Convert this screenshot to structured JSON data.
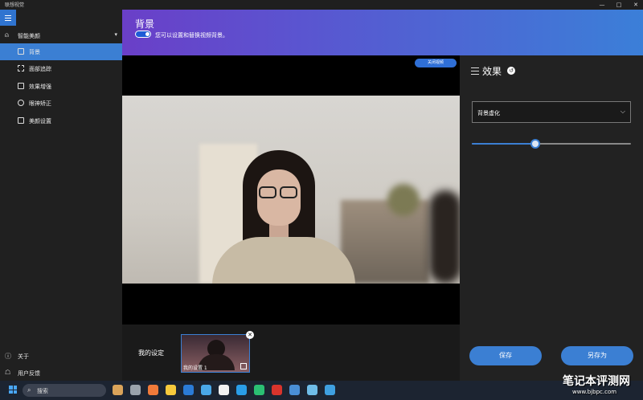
{
  "window": {
    "title": "联想视觉",
    "controls": [
      "—",
      "□",
      "✕"
    ]
  },
  "sidebar": {
    "group_label": "智能美颜",
    "items": [
      {
        "label": "背景",
        "active": true
      },
      {
        "label": "面部追踪",
        "active": false
      },
      {
        "label": "效果增强",
        "active": false
      },
      {
        "label": "眼神矫正",
        "active": false
      },
      {
        "label": "美颜设置",
        "active": false
      }
    ],
    "bottom": [
      {
        "label": "关于",
        "icon": "info-icon"
      },
      {
        "label": "用户反馈",
        "icon": "feedback-icon"
      }
    ]
  },
  "header": {
    "title": "背景",
    "toggle_on": true,
    "description": "您可以设置和替换视频背景。"
  },
  "video": {
    "close_label": "关闭视频"
  },
  "my_settings": {
    "label": "我的设定",
    "preset_name": "我的设置 1"
  },
  "panel": {
    "title": "效果",
    "select_value": "背景虚化",
    "slider_level": 0.4
  },
  "buttons": {
    "save": "保存",
    "save_as": "另存为"
  },
  "taskbar": {
    "search_text": "搜索",
    "icon_colors": [
      "#d9a35a",
      "#9aa3ad",
      "#f07a3a",
      "#f6c93c",
      "#2b7bd6",
      "#4aa8e8",
      "#f2f2f2",
      "#2a9ee8",
      "#2bbf73",
      "#d8342c",
      "#4a8fd6",
      "#6fbde8",
      "#3fa0e0"
    ]
  },
  "watermark": {
    "main": "笔记本评测网",
    "sub": "www.bjbpc.com"
  },
  "colors": {
    "accent": "#3b7fd3",
    "banner_start": "#6a3fc8",
    "banner_end": "#3b7fd8"
  }
}
